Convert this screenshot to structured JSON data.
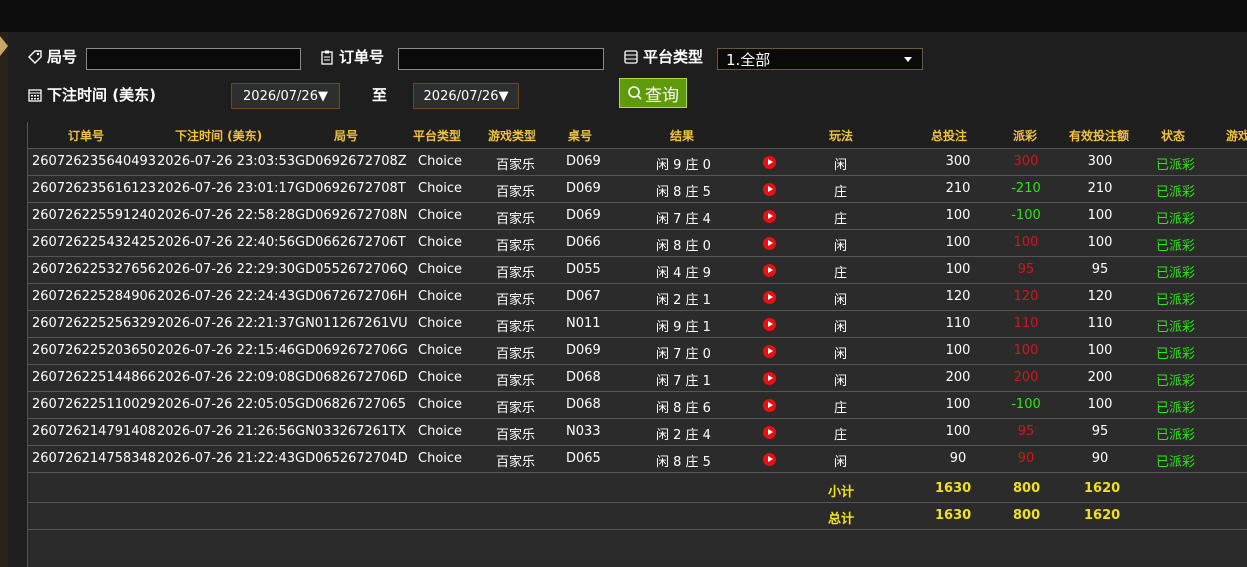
{
  "filters": {
    "round_label": "局号",
    "round_value": "",
    "order_label": "订单号",
    "order_value": "",
    "platform_label": "平台类型",
    "platform_selected": "1.全部",
    "time_label": "下注时间 (美东)",
    "date_from": "2026/07/26▼",
    "to_label": "至",
    "date_to": "2026/07/26▼",
    "query_label": "查询"
  },
  "table": {
    "headers": [
      "订单号",
      "下注时间 (美东)",
      "局号",
      "平台类型",
      "游戏类型",
      "桌号",
      "结果",
      "玩法",
      "总投注",
      "派彩",
      "有效投注额",
      "状态",
      "游戏"
    ],
    "rows": [
      {
        "order": "260726235640493",
        "time": "2026-07-26 23:03:53",
        "round": "GD0692672708Z",
        "platform": "Choice",
        "game": "百家乐",
        "table": "D069",
        "result": "闲 9 庄 0",
        "play": "闲",
        "bet": "300",
        "payout": "300",
        "payout_sign": "red",
        "valid": "300",
        "status": "已派彩"
      },
      {
        "order": "260726235616123",
        "time": "2026-07-26 23:01:17",
        "round": "GD0692672708T",
        "platform": "Choice",
        "game": "百家乐",
        "table": "D069",
        "result": "闲 8 庄 5",
        "play": "庄",
        "bet": "210",
        "payout": "-210",
        "payout_sign": "green",
        "valid": "210",
        "status": "已派彩"
      },
      {
        "order": "260726225591240",
        "time": "2026-07-26 22:58:28",
        "round": "GD0692672708N",
        "platform": "Choice",
        "game": "百家乐",
        "table": "D069",
        "result": "闲 7 庄 4",
        "play": "庄",
        "bet": "100",
        "payout": "-100",
        "payout_sign": "green",
        "valid": "100",
        "status": "已派彩"
      },
      {
        "order": "260726225432425",
        "time": "2026-07-26 22:40:56",
        "round": "GD0662672706T",
        "platform": "Choice",
        "game": "百家乐",
        "table": "D066",
        "result": "闲 8 庄 0",
        "play": "闲",
        "bet": "100",
        "payout": "100",
        "payout_sign": "red",
        "valid": "100",
        "status": "已派彩"
      },
      {
        "order": "260726225327656",
        "time": "2026-07-26 22:29:30",
        "round": "GD0552672706Q",
        "platform": "Choice",
        "game": "百家乐",
        "table": "D055",
        "result": "闲 4 庄 9",
        "play": "庄",
        "bet": "100",
        "payout": "95",
        "payout_sign": "red",
        "valid": "95",
        "status": "已派彩"
      },
      {
        "order": "260726225284906",
        "time": "2026-07-26 22:24:43",
        "round": "GD0672672706H",
        "platform": "Choice",
        "game": "百家乐",
        "table": "D067",
        "result": "闲 2 庄 1",
        "play": "闲",
        "bet": "120",
        "payout": "120",
        "payout_sign": "red",
        "valid": "120",
        "status": "已派彩"
      },
      {
        "order": "260726225256329",
        "time": "2026-07-26 22:21:37",
        "round": "GN011267261VU",
        "platform": "Choice",
        "game": "百家乐",
        "table": "N011",
        "result": "闲 9 庄 1",
        "play": "闲",
        "bet": "110",
        "payout": "110",
        "payout_sign": "red",
        "valid": "110",
        "status": "已派彩"
      },
      {
        "order": "260726225203650",
        "time": "2026-07-26 22:15:46",
        "round": "GD0692672706G",
        "platform": "Choice",
        "game": "百家乐",
        "table": "D069",
        "result": "闲 7 庄 0",
        "play": "闲",
        "bet": "100",
        "payout": "100",
        "payout_sign": "red",
        "valid": "100",
        "status": "已派彩"
      },
      {
        "order": "260726225144866",
        "time": "2026-07-26 22:09:08",
        "round": "GD0682672706D",
        "platform": "Choice",
        "game": "百家乐",
        "table": "D068",
        "result": "闲 7 庄 1",
        "play": "闲",
        "bet": "200",
        "payout": "200",
        "payout_sign": "red",
        "valid": "200",
        "status": "已派彩"
      },
      {
        "order": "260726225110029",
        "time": "2026-07-26 22:05:05",
        "round": "GD06826727065",
        "platform": "Choice",
        "game": "百家乐",
        "table": "D068",
        "result": "闲 8 庄 6",
        "play": "庄",
        "bet": "100",
        "payout": "-100",
        "payout_sign": "green",
        "valid": "100",
        "status": "已派彩"
      },
      {
        "order": "260726214791408",
        "time": "2026-07-26 21:26:56",
        "round": "GN033267261TX",
        "platform": "Choice",
        "game": "百家乐",
        "table": "N033",
        "result": "闲 2 庄 4",
        "play": "庄",
        "bet": "100",
        "payout": "95",
        "payout_sign": "red",
        "valid": "95",
        "status": "已派彩"
      },
      {
        "order": "260726214758348",
        "time": "2026-07-26 21:22:43",
        "round": "GD0652672704D",
        "platform": "Choice",
        "game": "百家乐",
        "table": "D065",
        "result": "闲 8 庄 5",
        "play": "闲",
        "bet": "90",
        "payout": "90",
        "payout_sign": "red",
        "valid": "90",
        "status": "已派彩"
      }
    ],
    "subtotal": {
      "label": "小计",
      "bet": "1630",
      "payout": "800",
      "valid": "1620"
    },
    "total": {
      "label": "总计",
      "bet": "1630",
      "payout": "800",
      "valid": "1620"
    }
  },
  "colors": {
    "accent": "#f0c040",
    "positive": "#33e01a",
    "negative": "#d01818",
    "query_bg": "#5f9a0a"
  },
  "icons": [
    "tag-icon",
    "clipboard-icon",
    "server-icon",
    "calendar-icon",
    "search-icon",
    "play-icon"
  ]
}
